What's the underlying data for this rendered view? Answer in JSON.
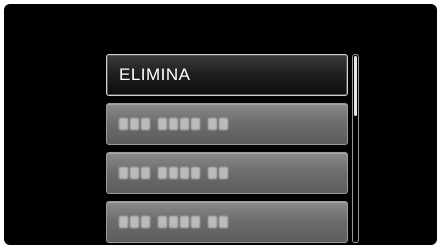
{
  "menu": {
    "items": [
      {
        "label": "ELIMINA",
        "selected": true
      },
      {
        "label": "",
        "obscured": true,
        "word_lengths": [
          3,
          4,
          2
        ]
      },
      {
        "label": "",
        "obscured": true,
        "word_lengths": [
          3,
          4,
          2
        ]
      },
      {
        "label": "",
        "obscured": true,
        "word_lengths": [
          3,
          4,
          2
        ]
      }
    ]
  },
  "scrollbar": {
    "position_fraction": 0.0
  },
  "colors": {
    "background": "#000000",
    "item_fill": "#6e6e6e",
    "selected_fill": "#1e1e1e",
    "border": "#9a9a9a",
    "text": "#ffffff"
  }
}
